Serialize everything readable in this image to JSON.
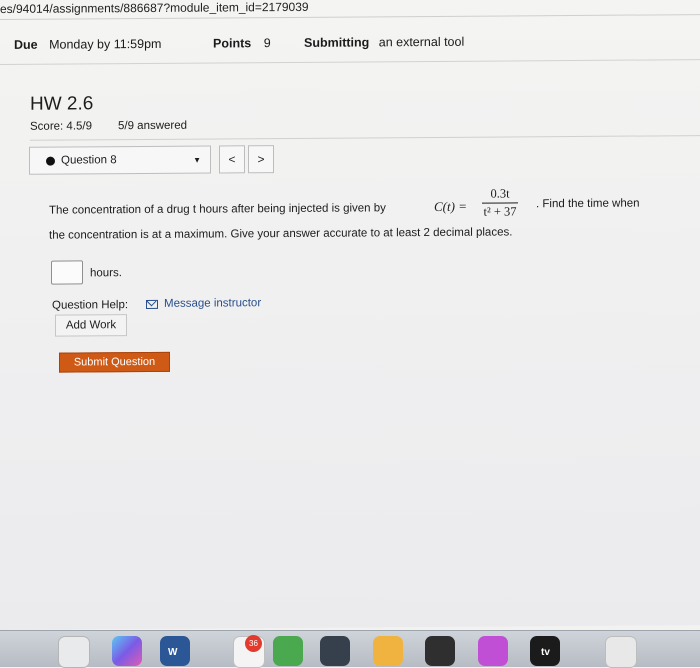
{
  "url": "es/94014/assignments/886687?module_item_id=2179039",
  "header": {
    "due_label": "Due",
    "due_value": "Monday by 11:59pm",
    "points_label": "Points",
    "points_value": "9",
    "submitting_label": "Submitting",
    "submitting_value": "an external tool"
  },
  "assignment": {
    "title": "HW 2.6",
    "score": "Score: 4.5/9",
    "answered": "5/9 answered"
  },
  "question_nav": {
    "selected": "Question 8",
    "prev_label": "<",
    "next_label": ">"
  },
  "problem": {
    "line1": "The concentration of a drug t hours after being injected is given by",
    "function": "C(t) =",
    "numerator": "0.3t",
    "denominator": "t² + 37",
    "line1_tail": ". Find the time when",
    "line2": "the concentration is at a maximum. Give your answer accurate to at least 2 decimal places."
  },
  "answer": {
    "value": "",
    "unit": "hours."
  },
  "help": {
    "label": "Question Help:",
    "message_link": "Message instructor",
    "add_work": "Add Work"
  },
  "submit_label": "Submit Question",
  "dock": {
    "badge": "36",
    "tv_label": "tv"
  }
}
